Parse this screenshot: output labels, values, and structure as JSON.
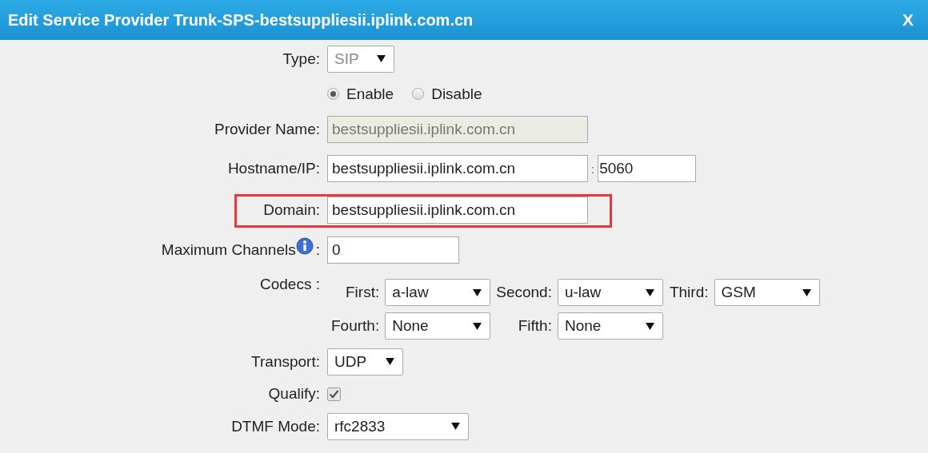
{
  "dialog": {
    "title": "Edit Service Provider Trunk-SPS-bestsuppliesii.iplink.com.cn",
    "close": "X"
  },
  "fields": [
    {
      "kind": "select",
      "label": "Type:",
      "value": "SIP",
      "disabled": true
    },
    {
      "kind": "radio",
      "options": [
        {
          "label": "Enable",
          "selected": true
        },
        {
          "label": "Disable",
          "selected": false
        }
      ]
    },
    {
      "kind": "text",
      "label": "Provider Name:",
      "value": "bestsuppliesii.iplink.com.cn",
      "disabled": true
    },
    {
      "kind": "host",
      "label": "Hostname/IP:",
      "value": "bestsuppliesii.iplink.com.cn",
      "separator": ":",
      "port": "5060"
    },
    {
      "kind": "text",
      "label": "Domain:",
      "value": "bestsuppliesii.iplink.com.cn",
      "disabled": false,
      "highlighted": true
    },
    {
      "kind": "info",
      "label": "Maximum Channels",
      "suffix": ":",
      "value": "0"
    },
    {
      "kind": "codecs",
      "label": "Codecs :",
      "slots": [
        {
          "label": "First:",
          "value": "a-law"
        },
        {
          "label": "Second:",
          "value": "u-law"
        },
        {
          "label": "Third:",
          "value": "GSM"
        },
        {
          "label": "Fourth:",
          "value": "None"
        },
        {
          "label": "Fifth:",
          "value": "None"
        }
      ]
    },
    {
      "kind": "select",
      "label": "Transport:",
      "value": "UDP",
      "disabled": false
    },
    {
      "kind": "checkbox",
      "label": "Qualify:",
      "checked": true,
      "disabled": true
    },
    {
      "kind": "select",
      "label": "DTMF Mode:",
      "value": "rfc2833",
      "disabled": false
    }
  ]
}
